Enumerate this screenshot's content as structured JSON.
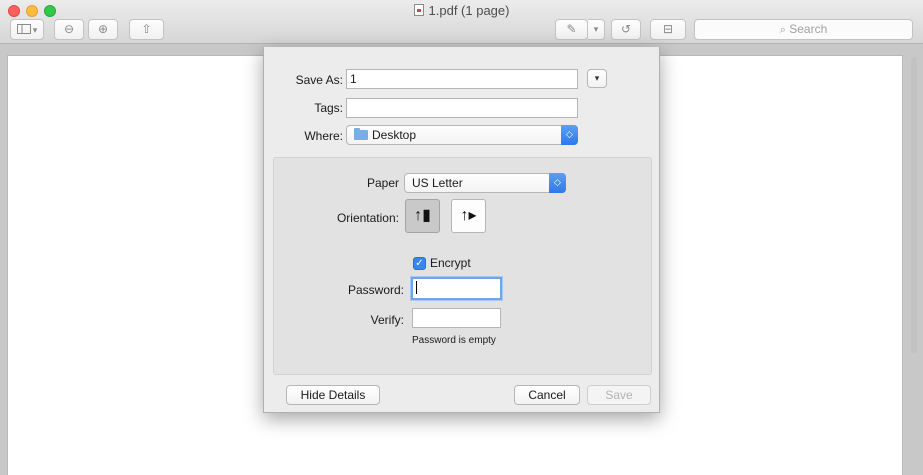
{
  "window": {
    "title": "1.pdf (1 page)"
  },
  "toolbar": {
    "sidebar_icon": "sidebar-icon",
    "sidebar_menu_glyph": "▾",
    "zoom_out_glyph": "⊖",
    "zoom_in_glyph": "⊕",
    "share_glyph": "⇧",
    "markup_glyph": "✎",
    "markup_menu_glyph": "▾",
    "rotate_glyph": "↺",
    "toolbox_glyph": "⊟",
    "search_placeholder": "Search"
  },
  "save_sheet": {
    "save_as_label": "Save As:",
    "save_as_value": "1",
    "expand_glyph": "▾",
    "tags_label": "Tags:",
    "tags_value": "",
    "where_label": "Where:",
    "where_value": "Desktop",
    "paper_label": "Paper",
    "paper_value": "US Letter",
    "orientation_label": "Orientation:",
    "orientation_portrait_glyph": "↑▮",
    "orientation_landscape_glyph": "↑▸",
    "orientation_selected": "portrait",
    "encrypt_checked_glyph": "✓",
    "encrypt_label": "Encrypt",
    "password_label": "Password:",
    "password_value": "",
    "verify_label": "Verify:",
    "verify_value": "",
    "password_hint": "Password is empty",
    "hide_details_label": "Hide Details",
    "cancel_label": "Cancel",
    "save_label": "Save"
  },
  "colors": {
    "accent": "#3b86ee",
    "close": "#fc605c",
    "minimize": "#fdbc40",
    "maximize": "#34c84a"
  }
}
